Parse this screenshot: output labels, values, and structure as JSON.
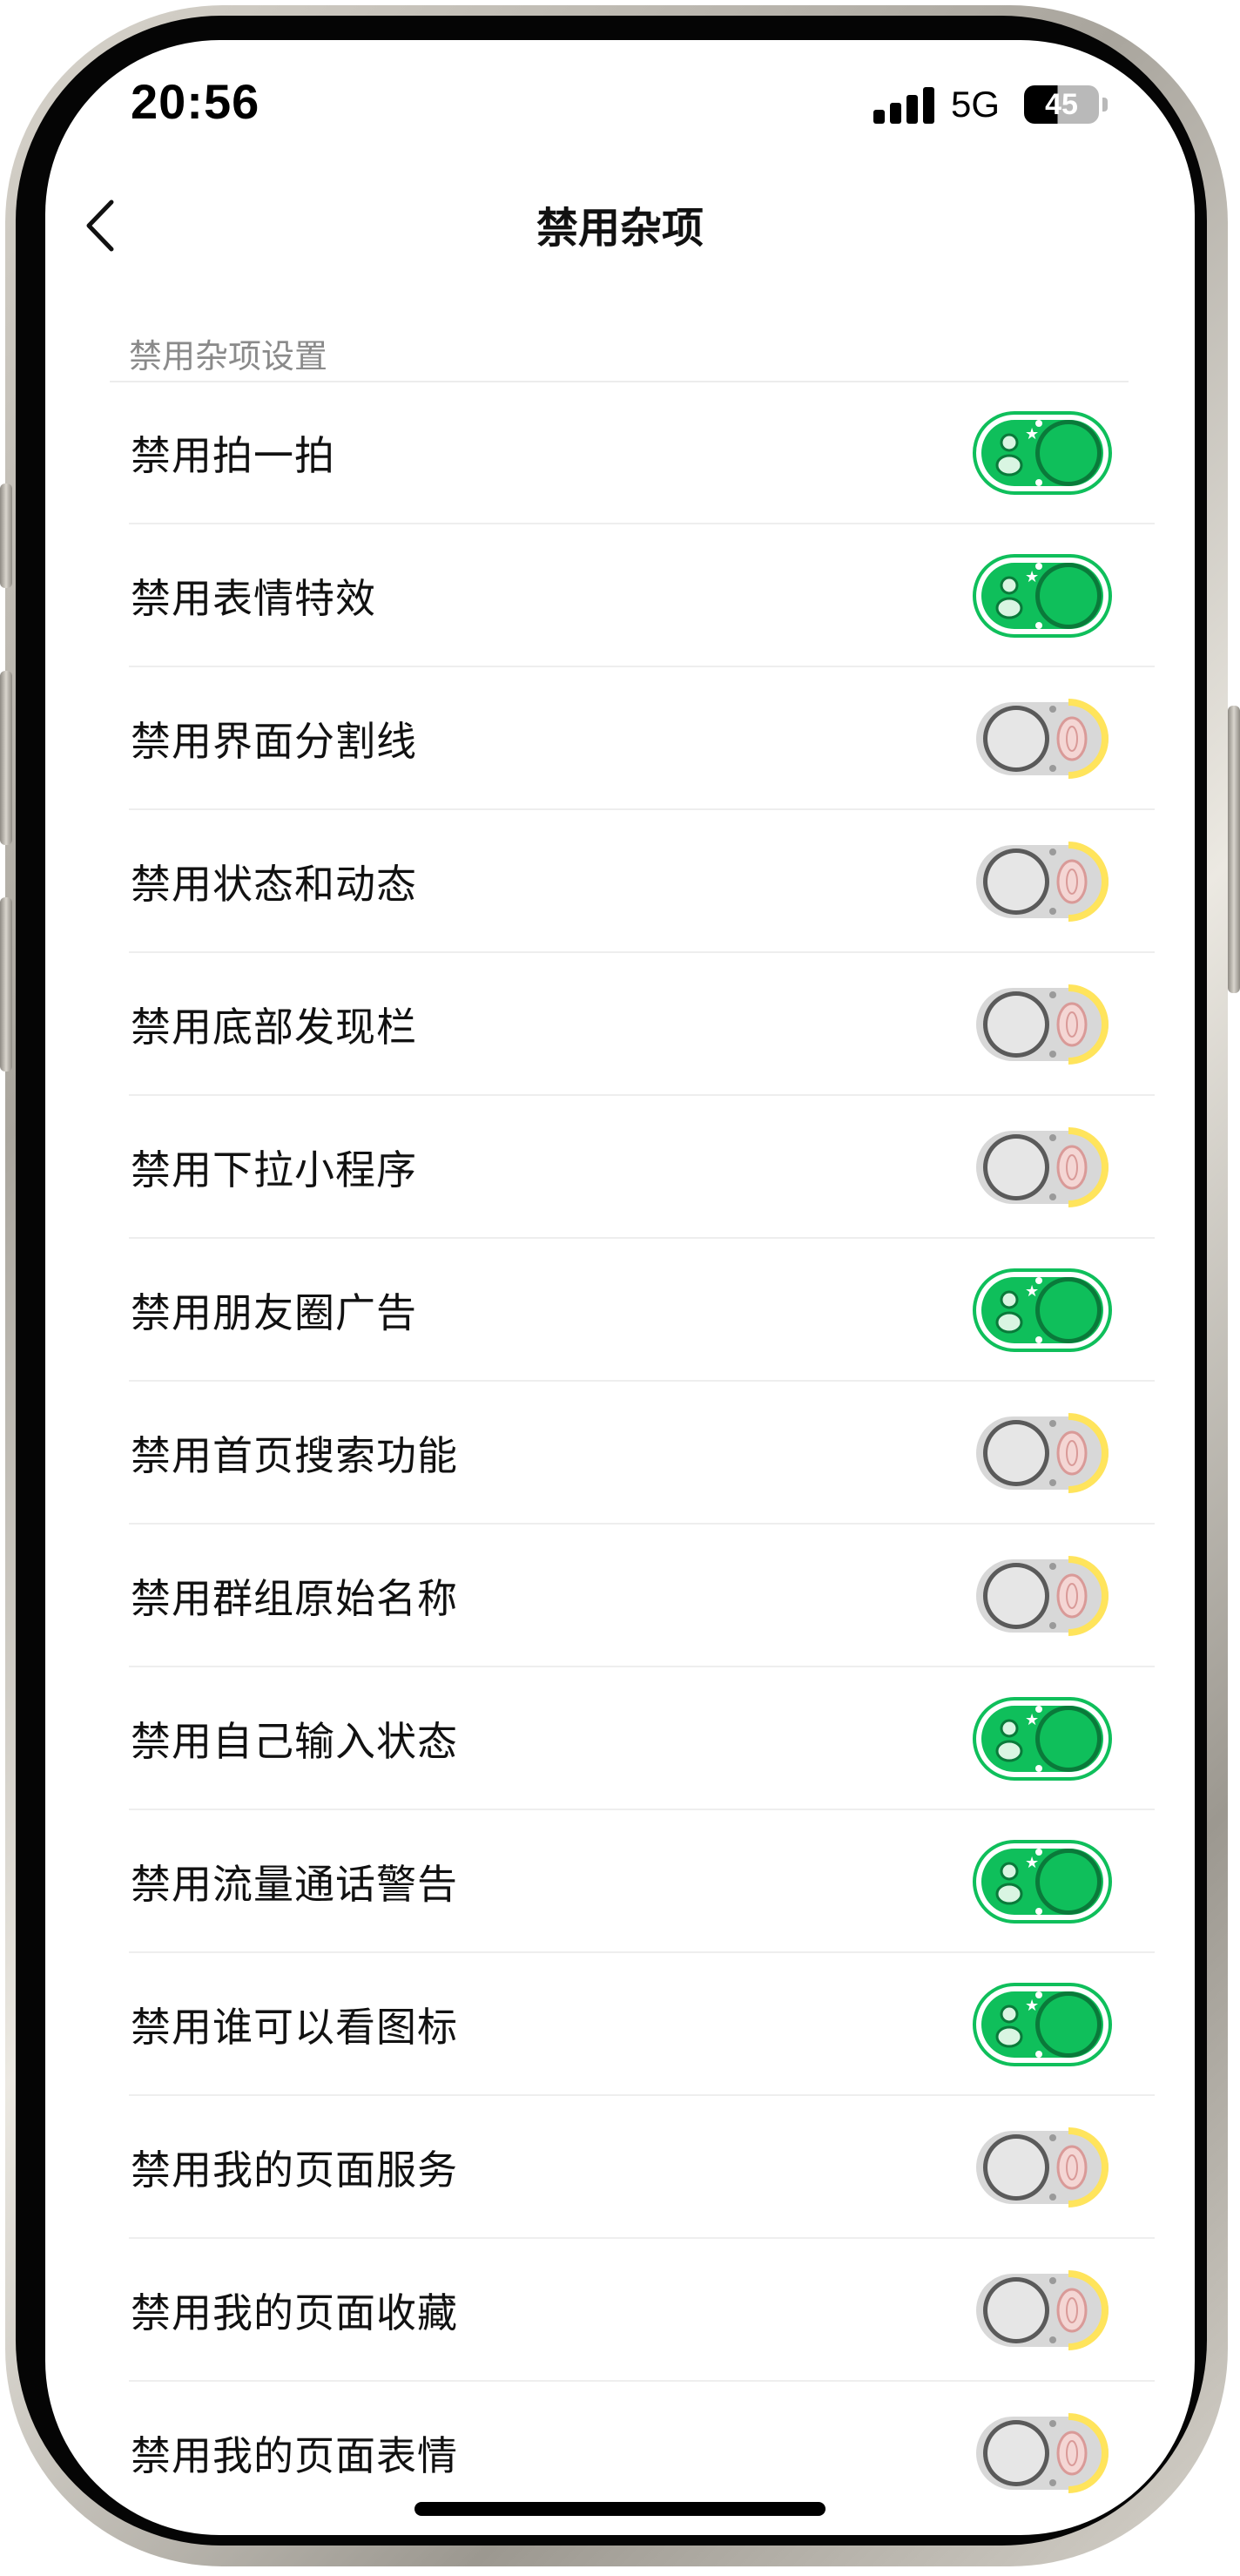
{
  "status_bar": {
    "time": "20:56",
    "network": "5G",
    "battery": "45"
  },
  "nav": {
    "back_icon": "chevron-left-icon",
    "title": "禁用杂项"
  },
  "section": {
    "header": "禁用杂项设置"
  },
  "colors": {
    "toggle_on": "#0fbf5b",
    "toggle_off_ring": "#ffe45c",
    "toggle_off_knob": "#e6e6e6"
  },
  "settings": [
    {
      "label": "禁用拍一拍",
      "on": true
    },
    {
      "label": "禁用表情特效",
      "on": true
    },
    {
      "label": "禁用界面分割线",
      "on": false
    },
    {
      "label": "禁用状态和动态",
      "on": false
    },
    {
      "label": "禁用底部发现栏",
      "on": false
    },
    {
      "label": "禁用下拉小程序",
      "on": false
    },
    {
      "label": "禁用朋友圈广告",
      "on": true
    },
    {
      "label": "禁用首页搜索功能",
      "on": false
    },
    {
      "label": "禁用群组原始名称",
      "on": false
    },
    {
      "label": "禁用自己输入状态",
      "on": true
    },
    {
      "label": "禁用流量通话警告",
      "on": true
    },
    {
      "label": "禁用谁可以看图标",
      "on": true
    },
    {
      "label": "禁用我的页面服务",
      "on": false
    },
    {
      "label": "禁用我的页面收藏",
      "on": false
    },
    {
      "label": "禁用我的页面表情",
      "on": false
    }
  ]
}
